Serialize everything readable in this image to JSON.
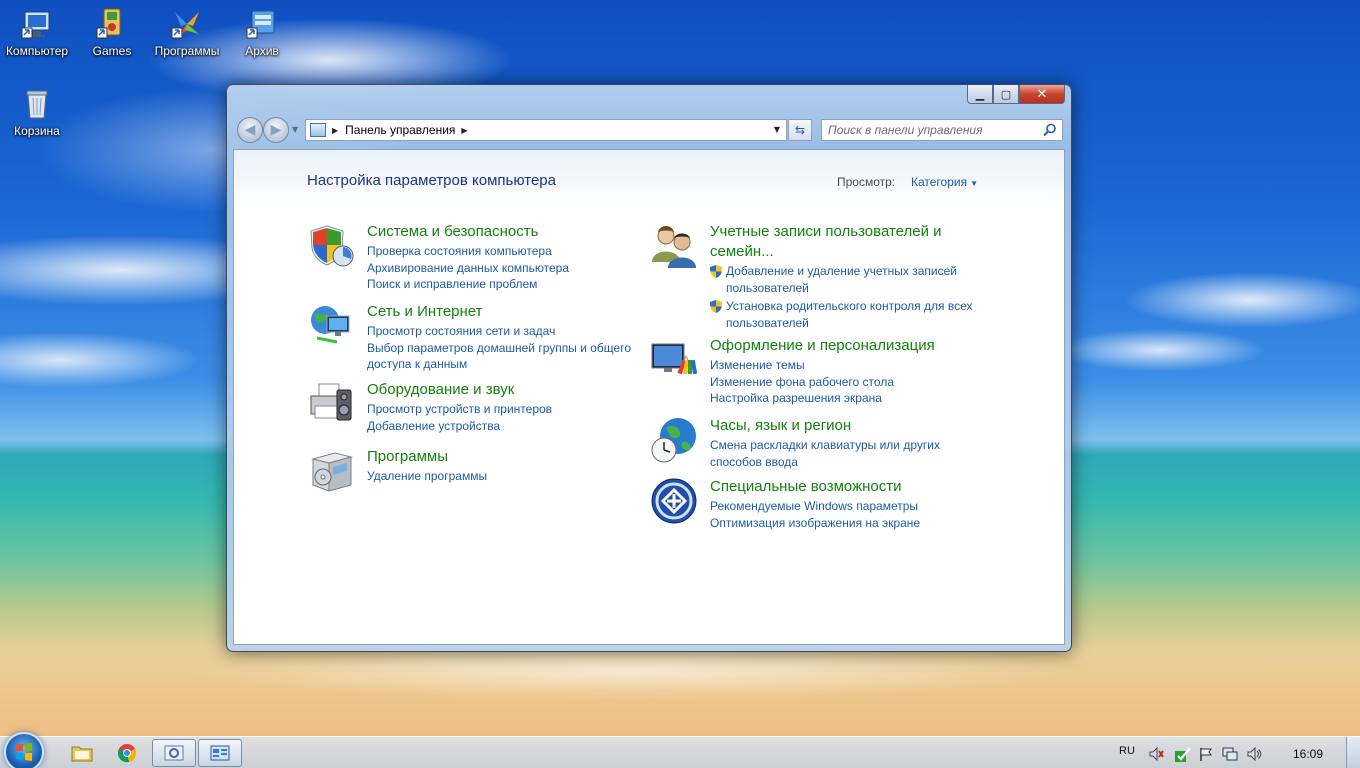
{
  "desktop": {
    "icons": [
      {
        "label": "Компьютер",
        "icon": "computer-icon"
      },
      {
        "label": "Games",
        "icon": "games-icon"
      },
      {
        "label": "Программы",
        "icon": "programs-icon"
      },
      {
        "label": "Архив",
        "icon": "archive-icon"
      },
      {
        "label": "Корзина",
        "icon": "recycle-bin-icon"
      }
    ]
  },
  "window": {
    "address": {
      "crumb": "Панель управления"
    },
    "search_placeholder": "Поиск в панели управления",
    "page_title": "Настройка параметров компьютера",
    "view_label": "Просмотр:",
    "view_value": "Категория",
    "categories_left": [
      {
        "title": "Система и безопасность",
        "icon": "shield-system-icon",
        "links": [
          "Проверка состояния компьютера",
          "Архивирование данных компьютера",
          "Поиск и исправление проблем"
        ]
      },
      {
        "title": "Сеть и Интернет",
        "icon": "network-globe-icon",
        "links": [
          "Просмотр состояния сети и задач",
          "Выбор параметров домашней группы и общего доступа к данным"
        ]
      },
      {
        "title": "Оборудование и звук",
        "icon": "printer-icon",
        "links": [
          "Просмотр устройств и принтеров",
          "Добавление устройства"
        ]
      },
      {
        "title": "Программы",
        "icon": "programs-box-icon",
        "links": [
          "Удаление программы"
        ]
      }
    ],
    "categories_right": [
      {
        "title": "Учетные записи пользователей и семейн...",
        "icon": "users-icon",
        "links": [
          "Добавление и удаление учетных записей пользователей",
          "Установка родительского контроля для всех пользователей"
        ]
      },
      {
        "title": "Оформление и персонализация",
        "icon": "personalization-icon",
        "links": [
          "Изменение темы",
          "Изменение фона рабочего стола",
          "Настройка разрешения экрана"
        ]
      },
      {
        "title": "Часы, язык и регион",
        "icon": "clock-globe-icon",
        "links": [
          "Смена раскладки клавиатуры или других способов ввода"
        ]
      },
      {
        "title": "Специальные возможности",
        "icon": "accessibility-icon",
        "links": [
          "Рекомендуемые Windows параметры",
          "Оптимизация изображения на экране"
        ]
      }
    ]
  },
  "taskbar": {
    "language": "RU",
    "time": "16:09"
  }
}
